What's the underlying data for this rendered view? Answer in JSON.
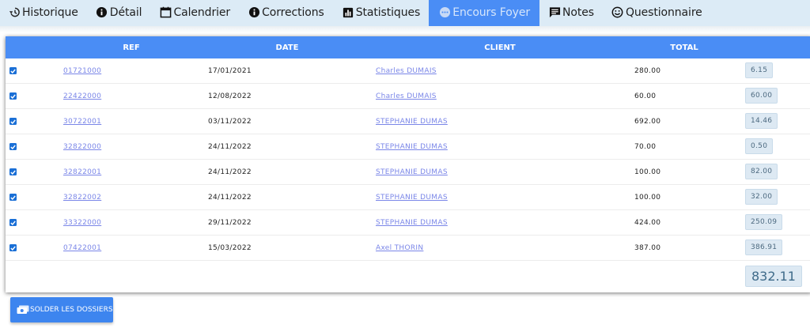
{
  "nav": {
    "items": [
      {
        "label": "Historique",
        "icon": "history-icon"
      },
      {
        "label": "Détail",
        "icon": "info-icon"
      },
      {
        "label": "Calendrier",
        "icon": "calendar-icon"
      },
      {
        "label": "Corrections",
        "icon": "info-icon"
      },
      {
        "label": "Statistiques",
        "icon": "bar-chart-icon"
      },
      {
        "label": "Encours Foyer",
        "icon": "more-horizontal-icon",
        "active": true
      },
      {
        "label": "Notes",
        "icon": "comment-icon"
      },
      {
        "label": "Questionnaire",
        "icon": "smile-icon"
      }
    ]
  },
  "table": {
    "headers": {
      "ref": "REF",
      "date": "DATE",
      "client": "CLIENT",
      "total": "TOTAL"
    },
    "rows": [
      {
        "checked": true,
        "ref": "01721000",
        "date": "17/01/2021",
        "client": "Charles DUMAIS",
        "total": "280.00",
        "remaining": "6.15"
      },
      {
        "checked": true,
        "ref": "22422000",
        "date": "12/08/2022",
        "client": "Charles DUMAIS",
        "total": "60.00",
        "remaining": "60.00"
      },
      {
        "checked": true,
        "ref": "30722001",
        "date": "03/11/2022",
        "client": "STEPHANIE DUMAS",
        "total": "692.00",
        "remaining": "14.46"
      },
      {
        "checked": true,
        "ref": "32822000",
        "date": "24/11/2022",
        "client": "STEPHANIE DUMAS",
        "total": "70.00",
        "remaining": "0.50"
      },
      {
        "checked": true,
        "ref": "32822001",
        "date": "24/11/2022",
        "client": "STEPHANIE DUMAS",
        "total": "100.00",
        "remaining": "82.00"
      },
      {
        "checked": true,
        "ref": "32822002",
        "date": "24/11/2022",
        "client": "STEPHANIE DUMAS",
        "total": "100.00",
        "remaining": "32.00"
      },
      {
        "checked": true,
        "ref": "33322000",
        "date": "29/11/2022",
        "client": "STEPHANIE DUMAS",
        "total": "424.00",
        "remaining": "250.09"
      },
      {
        "checked": true,
        "ref": "07422001",
        "date": "15/03/2022",
        "client": "Axel THORIN",
        "total": "387.00",
        "remaining": "386.91"
      }
    ],
    "grand_total": "832.11"
  },
  "actions": {
    "solder_label": "SOLDER LES DOSSIERS",
    "solder_icon": "money-icon"
  },
  "colors": {
    "accent": "#4a8df5",
    "nav_bg": "#dcebf6",
    "link": "#7a86e8",
    "badge_bg": "#dde9f3"
  }
}
